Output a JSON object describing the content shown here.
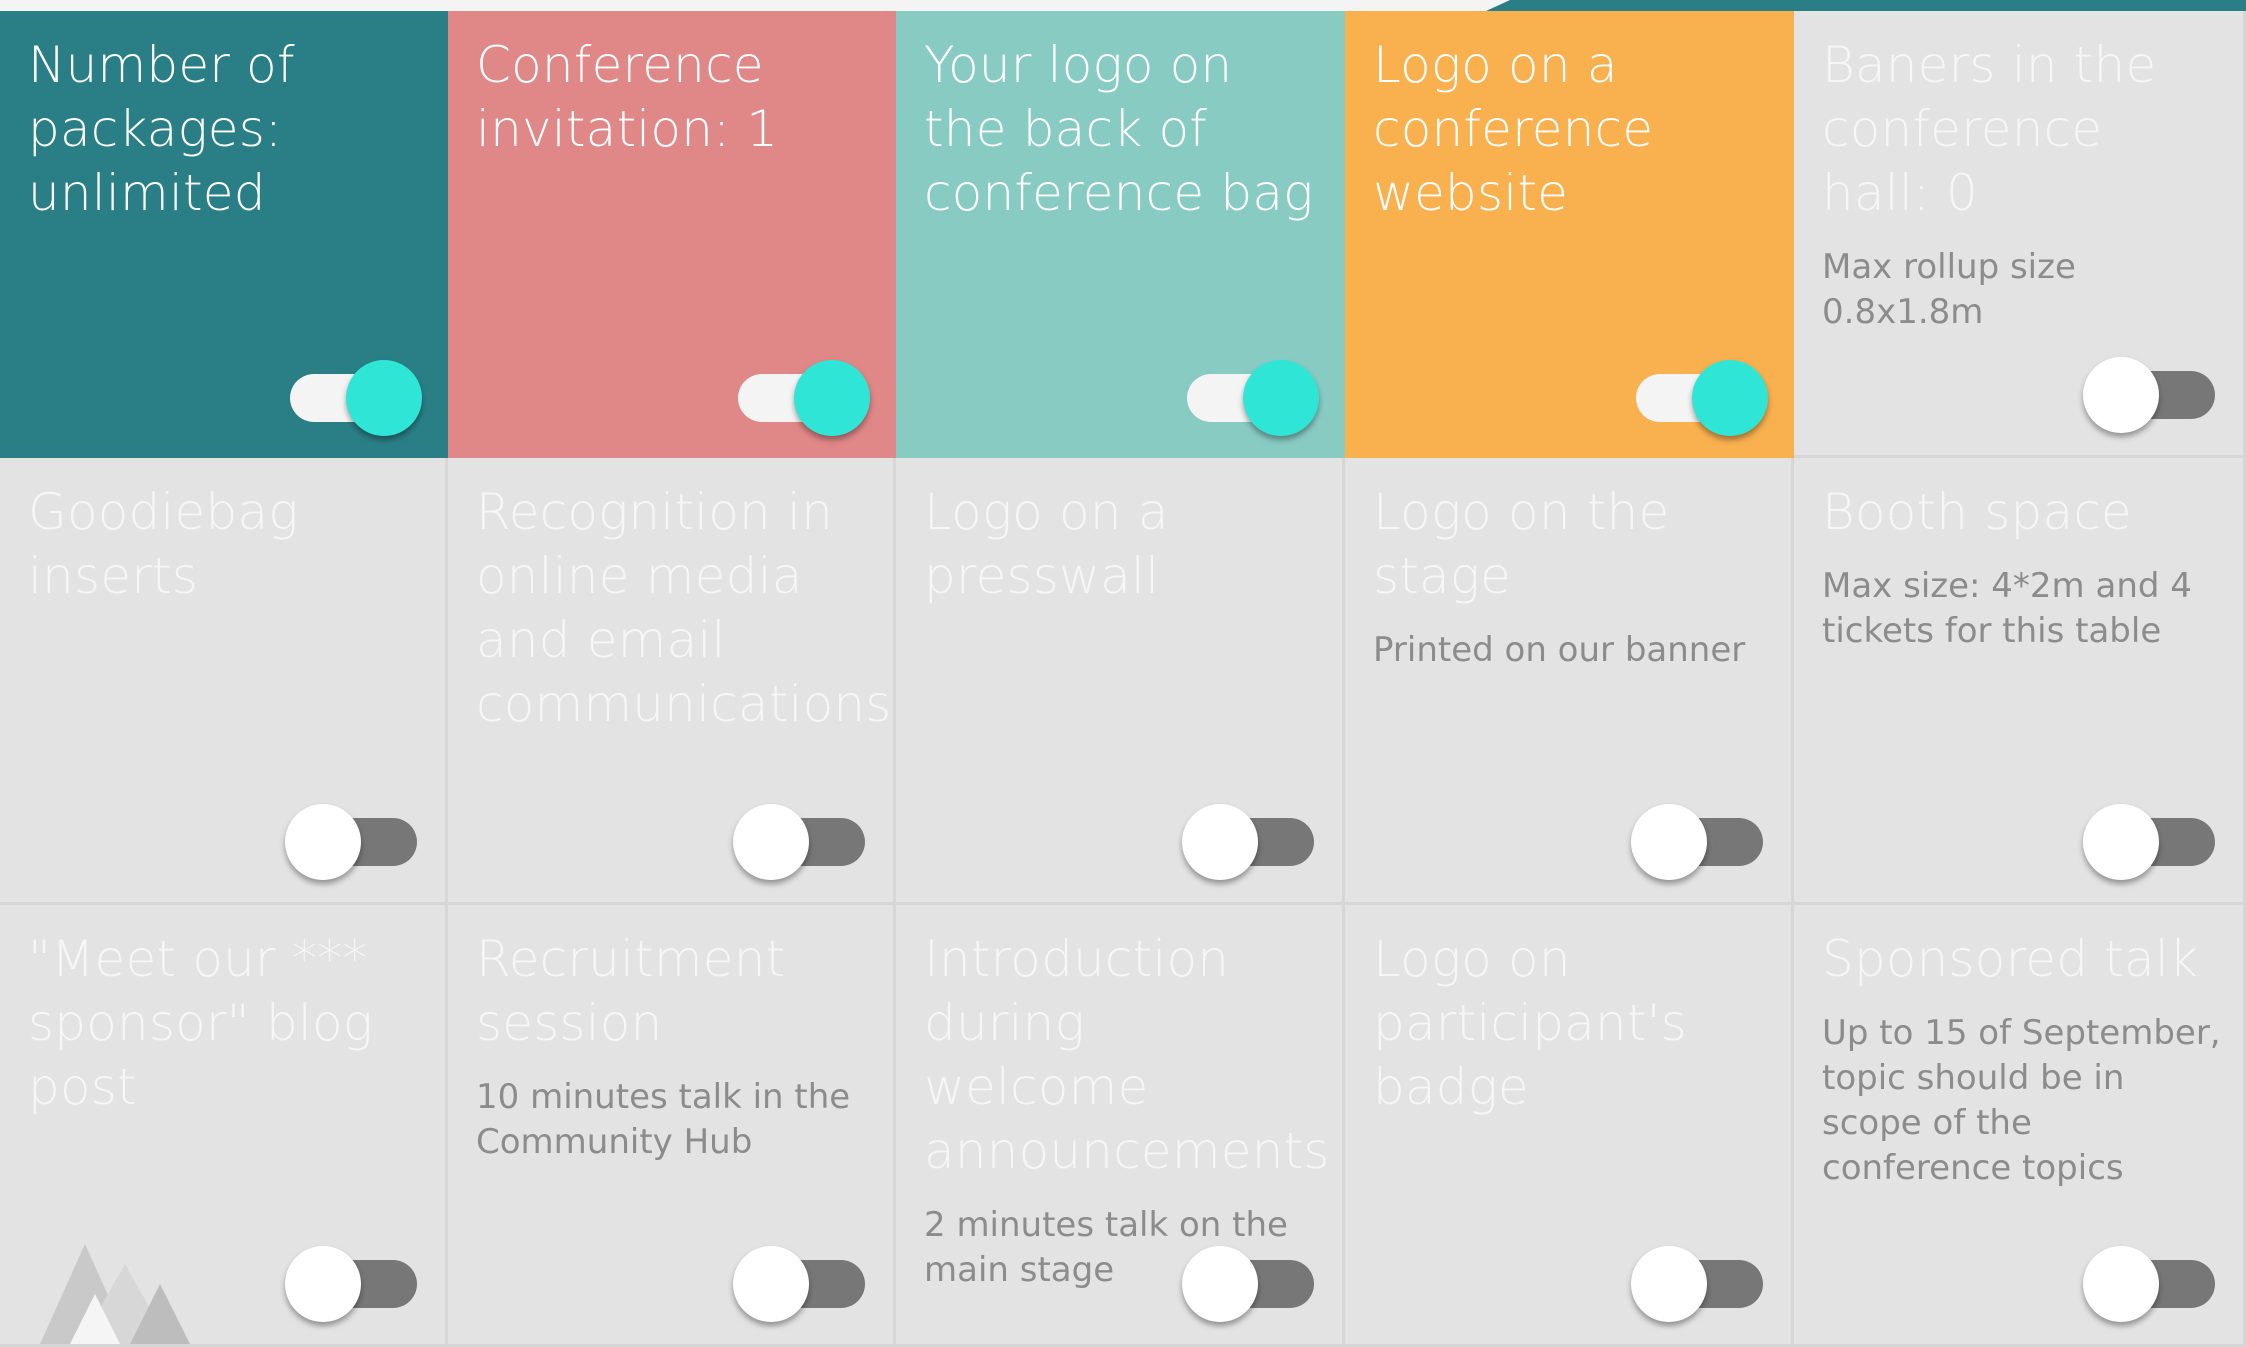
{
  "colors": {
    "teal": "#2a7f86",
    "coral": "#e08787",
    "mint": "#88cbc3",
    "orange": "#f9b04f",
    "grey_tile": "#e3e3e3",
    "toggle_knob_on": "#2fe6d6",
    "toggle_track_off": "#777777"
  },
  "tiles": [
    {
      "title": "Number of packages: unlimited",
      "desc": "",
      "state": "on",
      "color": "#2a7f86"
    },
    {
      "title": "Conference invitation: 1",
      "desc": "",
      "state": "on",
      "color": "#e08787"
    },
    {
      "title": "Your logo on the back of conference bag",
      "desc": "",
      "state": "on",
      "color": "#88cbc3"
    },
    {
      "title": "Logo on a conference website",
      "desc": "",
      "state": "on",
      "color": "#f9b04f"
    },
    {
      "title": "Baners in the conference hall: 0",
      "desc": "Max rollup size 0.8x1.8m",
      "state": "off",
      "color": "#e3e3e3"
    },
    {
      "title": "Goodiebag inserts",
      "desc": "",
      "state": "off",
      "color": "#e3e3e3"
    },
    {
      "title": "Recognition in online media and email communications",
      "desc": "",
      "state": "off",
      "color": "#e3e3e3"
    },
    {
      "title": "Logo on a presswall",
      "desc": "",
      "state": "off",
      "color": "#e3e3e3"
    },
    {
      "title": "Logo on the stage",
      "desc": "Printed on our banner",
      "state": "off",
      "color": "#e3e3e3"
    },
    {
      "title": "Booth space",
      "desc": "Max size: 4*2m and 4 tickets for this table",
      "state": "off",
      "color": "#e3e3e3"
    },
    {
      "title": "\"Meet our *** sponsor\" blog post",
      "desc": "",
      "state": "off",
      "color": "#e3e3e3"
    },
    {
      "title": "Recruitment session",
      "desc": "10 minutes talk in the Community Hub",
      "state": "off",
      "color": "#e3e3e3"
    },
    {
      "title": "Introduction during welcome announcements",
      "desc": "2 minutes talk on the main stage",
      "state": "off",
      "color": "#e3e3e3"
    },
    {
      "title": "Logo on participant's badge",
      "desc": "",
      "state": "off",
      "color": "#e3e3e3"
    },
    {
      "title": "Sponsored talk",
      "desc": "Up to 15 of September, topic should be in scope of the conference topics",
      "state": "off",
      "color": "#e3e3e3"
    }
  ],
  "icons": {
    "decorative": "mountain-logo-icon",
    "toggle": "toggle-switch"
  }
}
